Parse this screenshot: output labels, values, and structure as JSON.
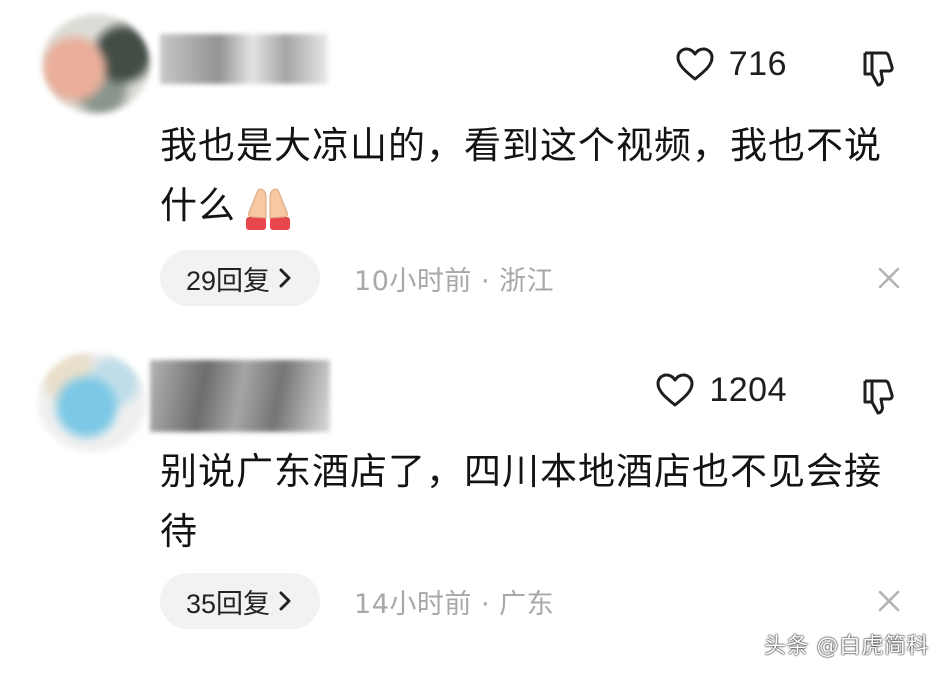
{
  "comments": [
    {
      "likes": "716",
      "text": "我也是大凉山的，看到这个视频，我也不说什么",
      "emoji": "folded-hands",
      "replies": "29回复",
      "time_location": "10小时前 · 浙江"
    },
    {
      "likes": "1204",
      "text": "别说广东酒店了，四川本地酒店也不见会接待",
      "replies": "35回复",
      "time_location": "14小时前 · 广东"
    }
  ],
  "watermark": "头条 @白虎简科",
  "icons": {
    "like": "heart-outline-icon",
    "dislike": "thumbs-down-icon",
    "expand": "chevron-right-icon",
    "dismiss": "close-icon"
  },
  "colors": {
    "text": "#131313",
    "meta_text": "#a8a8a8",
    "pill_bg": "#f2f2f2",
    "emoji_skin": "#f7c9a3",
    "emoji_sleeve": "#e8474c"
  }
}
